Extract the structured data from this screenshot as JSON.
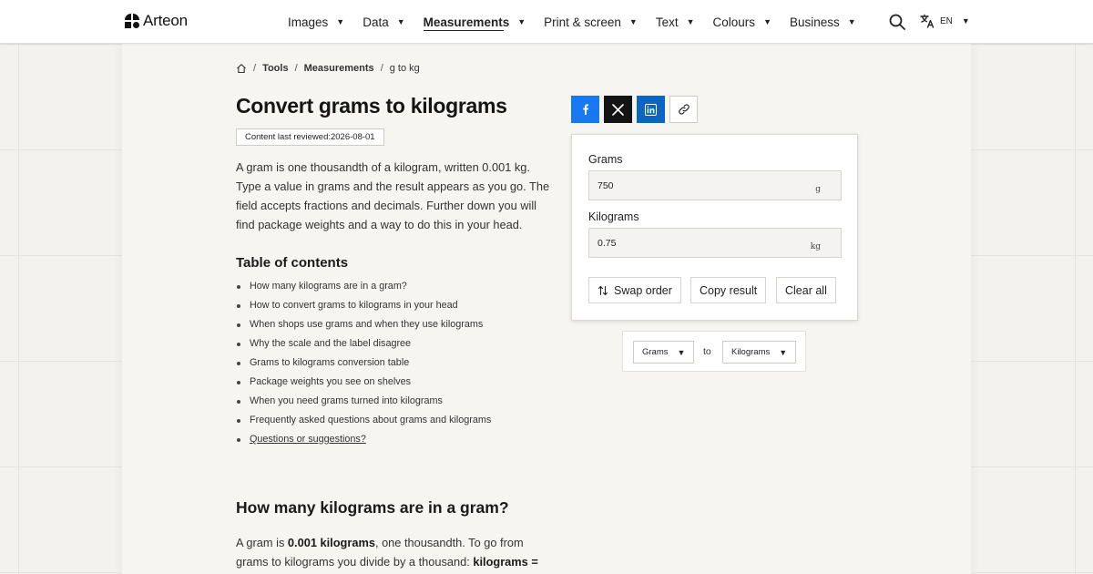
{
  "header": {
    "logo_text": "Arteon",
    "nav": [
      {
        "label": "Images",
        "active": false
      },
      {
        "label": "Data",
        "active": false
      },
      {
        "label": "Measurements",
        "active": true
      },
      {
        "label": "Print & screen",
        "active": false
      },
      {
        "label": "Text",
        "active": false
      },
      {
        "label": "Colours",
        "active": false
      },
      {
        "label": "Business",
        "active": false
      }
    ],
    "caret": "▼",
    "language": "EN",
    "icons": [
      "search-icon",
      "translate-icon",
      "home-icon"
    ]
  },
  "breadcrumb": {
    "items": [
      "Tools",
      "Measurements",
      "g to kg"
    ],
    "separator": "/"
  },
  "page": {
    "title": "Convert grams to kilograms",
    "reviewed": "Content last reviewed:2026-08-01",
    "intro": "A gram is one thousandth of a kilogram, written 0.001 kg. Type a value in grams and the result appears as you go. The field accepts fractions and decimals. Further down you will find package weights and a way to do this in your head."
  },
  "toc": {
    "heading": "Table of contents",
    "items": [
      "How many kilograms are in a gram?",
      "How to convert grams to kilograms in your head",
      "When shops use grams and when they use kilograms",
      "Why the scale and the label disagree",
      "Grams to kilograms conversion table",
      "Package weights you see on shelves",
      "When you need grams turned into kilograms",
      "Frequently asked questions about grams and kilograms",
      "Questions or suggestions?"
    ]
  },
  "section1": {
    "heading": "How many kilograms are in a gram?",
    "p_start": "A gram is ",
    "p_bold1": "0.001 kilograms",
    "p_mid": ", one thousandth. To go from grams to kilograms you divide by a thousand: ",
    "p_bold2": "kilograms ="
  },
  "share": {
    "icons": [
      "facebook-icon",
      "x-icon",
      "linkedin-icon",
      "link-icon"
    ],
    "colors": {
      "facebook": "#1877f2",
      "x": "#141414",
      "linkedin": "#0a66c2"
    }
  },
  "converter": {
    "from_label": "Grams",
    "from_value": "750",
    "from_unit": "g",
    "to_label": "Kilograms",
    "to_value": "0.75",
    "to_unit": "kg",
    "swap_label": "Swap order",
    "copy_label": "Copy result",
    "clear_label": "Clear all"
  },
  "unit_select": {
    "from": "Grams",
    "to_word": "to",
    "to": "Kilograms"
  }
}
